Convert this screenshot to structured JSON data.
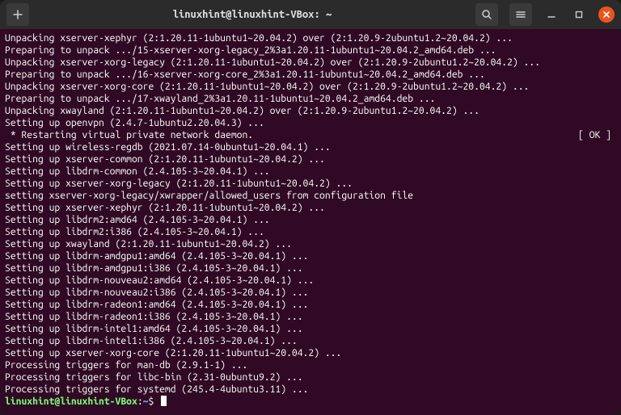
{
  "titlebar": {
    "title": "linuxhint@linuxhint-VBox: ~"
  },
  "restart_line": {
    "msg": " * Restarting virtual private network daemon.",
    "ok": "[ OK ]"
  },
  "prompt": {
    "userhost": "linuxhint@linuxhint-VBox",
    "colon": ":",
    "path": "~",
    "dollar": "$ "
  },
  "lines": [
    "Unpacking xserver-xephyr (2:1.20.11-1ubuntu1~20.04.2) over (2:1.20.9-2ubuntu1.2~20.04.2) ...",
    "Preparing to unpack .../15-xserver-xorg-legacy_2%3a1.20.11-1ubuntu1~20.04.2_amd64.deb ...",
    "Unpacking xserver-xorg-legacy (2:1.20.11-1ubuntu1~20.04.2) over (2:1.20.9-2ubuntu1.2~20.04.2) ...",
    "Preparing to unpack .../16-xserver-xorg-core_2%3a1.20.11-1ubuntu1~20.04.2_amd64.deb ...",
    "Unpacking xserver-xorg-core (2:1.20.11-1ubuntu1~20.04.2) over (2:1.20.9-2ubuntu1.2~20.04.2) ...",
    "Preparing to unpack .../17-xwayland_2%3a1.20.11-1ubuntu1~20.04.2_amd64.deb ...",
    "Unpacking xwayland (2:1.20.11-1ubuntu1~20.04.2) over (2:1.20.9-2ubuntu1.2~20.04.2) ...",
    "Setting up openvpn (2.4.7-1ubuntu2.20.04.3) ..."
  ],
  "lines2": [
    "Setting up wireless-regdb (2021.07.14-0ubuntu1~20.04.1) ...",
    "Setting up xserver-common (2:1.20.11-1ubuntu1~20.04.2) ...",
    "Setting up libdrm-common (2.4.105-3~20.04.1) ...",
    "Setting up xserver-xorg-legacy (2:1.20.11-1ubuntu1~20.04.2) ...",
    "setting xserver-xorg-legacy/xwrapper/allowed_users from configuration file",
    "Setting up xserver-xephyr (2:1.20.11-1ubuntu1~20.04.2) ...",
    "Setting up libdrm2:amd64 (2.4.105-3~20.04.1) ...",
    "Setting up libdrm2:i386 (2.4.105-3~20.04.1) ...",
    "Setting up xwayland (2:1.20.11-1ubuntu1~20.04.2) ...",
    "Setting up libdrm-amdgpu1:amd64 (2.4.105-3~20.04.1) ...",
    "Setting up libdrm-amdgpu1:i386 (2.4.105-3~20.04.1) ...",
    "Setting up libdrm-nouveau2:amd64 (2.4.105-3~20.04.1) ...",
    "Setting up libdrm-nouveau2:i386 (2.4.105-3~20.04.1) ...",
    "Setting up libdrm-radeon1:amd64 (2.4.105-3~20.04.1) ...",
    "Setting up libdrm-radeon1:i386 (2.4.105-3~20.04.1) ...",
    "Setting up libdrm-intel1:amd64 (2.4.105-3~20.04.1) ...",
    "Setting up libdrm-intel1:i386 (2.4.105-3~20.04.1) ...",
    "Setting up xserver-xorg-core (2:1.20.11-1ubuntu1~20.04.2) ...",
    "Processing triggers for man-db (2.9.1-1) ...",
    "Processing triggers for libc-bin (2.31-0ubuntu9.2) ...",
    "Processing triggers for systemd (245.4-4ubuntu3.11) ..."
  ]
}
